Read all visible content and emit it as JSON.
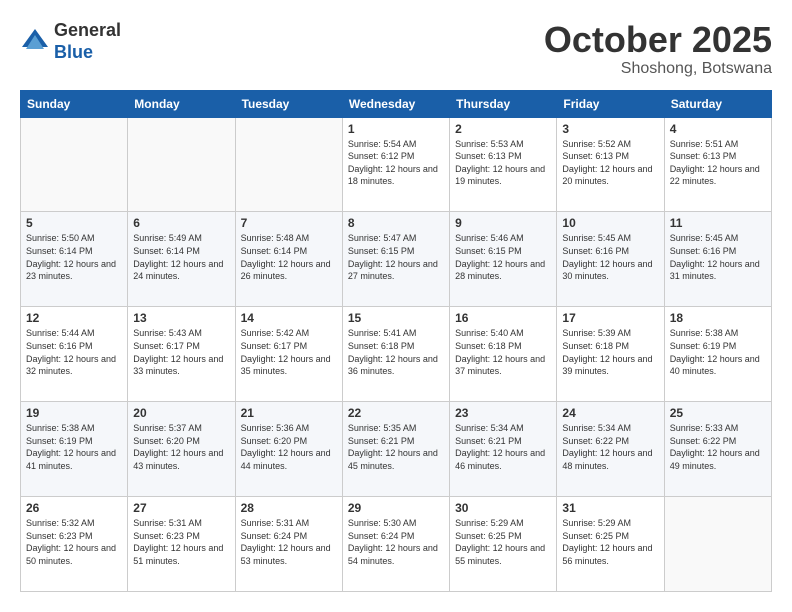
{
  "header": {
    "logo_line1": "General",
    "logo_line2": "Blue",
    "month_title": "October 2025",
    "location": "Shoshong, Botswana"
  },
  "calendar": {
    "days_of_week": [
      "Sunday",
      "Monday",
      "Tuesday",
      "Wednesday",
      "Thursday",
      "Friday",
      "Saturday"
    ],
    "weeks": [
      [
        {
          "day": "",
          "info": ""
        },
        {
          "day": "",
          "info": ""
        },
        {
          "day": "",
          "info": ""
        },
        {
          "day": "1",
          "info": "Sunrise: 5:54 AM\nSunset: 6:12 PM\nDaylight: 12 hours\nand 18 minutes."
        },
        {
          "day": "2",
          "info": "Sunrise: 5:53 AM\nSunset: 6:13 PM\nDaylight: 12 hours\nand 19 minutes."
        },
        {
          "day": "3",
          "info": "Sunrise: 5:52 AM\nSunset: 6:13 PM\nDaylight: 12 hours\nand 20 minutes."
        },
        {
          "day": "4",
          "info": "Sunrise: 5:51 AM\nSunset: 6:13 PM\nDaylight: 12 hours\nand 22 minutes."
        }
      ],
      [
        {
          "day": "5",
          "info": "Sunrise: 5:50 AM\nSunset: 6:14 PM\nDaylight: 12 hours\nand 23 minutes."
        },
        {
          "day": "6",
          "info": "Sunrise: 5:49 AM\nSunset: 6:14 PM\nDaylight: 12 hours\nand 24 minutes."
        },
        {
          "day": "7",
          "info": "Sunrise: 5:48 AM\nSunset: 6:14 PM\nDaylight: 12 hours\nand 26 minutes."
        },
        {
          "day": "8",
          "info": "Sunrise: 5:47 AM\nSunset: 6:15 PM\nDaylight: 12 hours\nand 27 minutes."
        },
        {
          "day": "9",
          "info": "Sunrise: 5:46 AM\nSunset: 6:15 PM\nDaylight: 12 hours\nand 28 minutes."
        },
        {
          "day": "10",
          "info": "Sunrise: 5:45 AM\nSunset: 6:16 PM\nDaylight: 12 hours\nand 30 minutes."
        },
        {
          "day": "11",
          "info": "Sunrise: 5:45 AM\nSunset: 6:16 PM\nDaylight: 12 hours\nand 31 minutes."
        }
      ],
      [
        {
          "day": "12",
          "info": "Sunrise: 5:44 AM\nSunset: 6:16 PM\nDaylight: 12 hours\nand 32 minutes."
        },
        {
          "day": "13",
          "info": "Sunrise: 5:43 AM\nSunset: 6:17 PM\nDaylight: 12 hours\nand 33 minutes."
        },
        {
          "day": "14",
          "info": "Sunrise: 5:42 AM\nSunset: 6:17 PM\nDaylight: 12 hours\nand 35 minutes."
        },
        {
          "day": "15",
          "info": "Sunrise: 5:41 AM\nSunset: 6:18 PM\nDaylight: 12 hours\nand 36 minutes."
        },
        {
          "day": "16",
          "info": "Sunrise: 5:40 AM\nSunset: 6:18 PM\nDaylight: 12 hours\nand 37 minutes."
        },
        {
          "day": "17",
          "info": "Sunrise: 5:39 AM\nSunset: 6:18 PM\nDaylight: 12 hours\nand 39 minutes."
        },
        {
          "day": "18",
          "info": "Sunrise: 5:38 AM\nSunset: 6:19 PM\nDaylight: 12 hours\nand 40 minutes."
        }
      ],
      [
        {
          "day": "19",
          "info": "Sunrise: 5:38 AM\nSunset: 6:19 PM\nDaylight: 12 hours\nand 41 minutes."
        },
        {
          "day": "20",
          "info": "Sunrise: 5:37 AM\nSunset: 6:20 PM\nDaylight: 12 hours\nand 43 minutes."
        },
        {
          "day": "21",
          "info": "Sunrise: 5:36 AM\nSunset: 6:20 PM\nDaylight: 12 hours\nand 44 minutes."
        },
        {
          "day": "22",
          "info": "Sunrise: 5:35 AM\nSunset: 6:21 PM\nDaylight: 12 hours\nand 45 minutes."
        },
        {
          "day": "23",
          "info": "Sunrise: 5:34 AM\nSunset: 6:21 PM\nDaylight: 12 hours\nand 46 minutes."
        },
        {
          "day": "24",
          "info": "Sunrise: 5:34 AM\nSunset: 6:22 PM\nDaylight: 12 hours\nand 48 minutes."
        },
        {
          "day": "25",
          "info": "Sunrise: 5:33 AM\nSunset: 6:22 PM\nDaylight: 12 hours\nand 49 minutes."
        }
      ],
      [
        {
          "day": "26",
          "info": "Sunrise: 5:32 AM\nSunset: 6:23 PM\nDaylight: 12 hours\nand 50 minutes."
        },
        {
          "day": "27",
          "info": "Sunrise: 5:31 AM\nSunset: 6:23 PM\nDaylight: 12 hours\nand 51 minutes."
        },
        {
          "day": "28",
          "info": "Sunrise: 5:31 AM\nSunset: 6:24 PM\nDaylight: 12 hours\nand 53 minutes."
        },
        {
          "day": "29",
          "info": "Sunrise: 5:30 AM\nSunset: 6:24 PM\nDaylight: 12 hours\nand 54 minutes."
        },
        {
          "day": "30",
          "info": "Sunrise: 5:29 AM\nSunset: 6:25 PM\nDaylight: 12 hours\nand 55 minutes."
        },
        {
          "day": "31",
          "info": "Sunrise: 5:29 AM\nSunset: 6:25 PM\nDaylight: 12 hours\nand 56 minutes."
        },
        {
          "day": "",
          "info": ""
        }
      ]
    ]
  }
}
